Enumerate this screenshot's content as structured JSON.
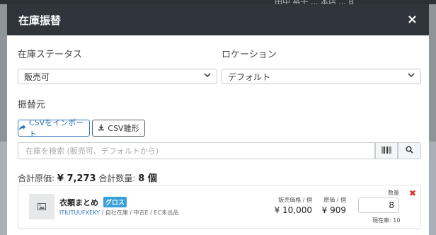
{
  "background": {
    "topbar_text": "田中 裕子 ... 本店 ... B"
  },
  "modal": {
    "title": "在庫振替",
    "close_symbol": "×"
  },
  "form": {
    "status_label": "在庫ステータス",
    "status_value": "販売可",
    "location_label": "ロケーション",
    "location_value": "デフォルト",
    "source_label": "振替元",
    "import_button": "CSVをインポート",
    "template_button": "CSV雛形",
    "search_placeholder": "在庫を検索 (販売可、デフォルトから)"
  },
  "totals": {
    "cost_label": "合計原価:",
    "cost_value": "¥ 7,273",
    "qty_label": "合計数量:",
    "qty_value": "8 個"
  },
  "item": {
    "name": "衣類まとめ",
    "badge": "グロス",
    "code": "ITIUTUUFXEKY",
    "meta": " / 自社在庫 / 中古E / EC未出品",
    "sale_price_label": "販売価格 / 個",
    "sale_price_value": "¥ 10,000",
    "cost_label": "原価 / 個",
    "cost_value": "¥ 909",
    "qty_label": "数量",
    "qty_value": "8",
    "stock_note": "現在庫: 10",
    "remove_symbol": "✖"
  },
  "icons": {
    "import": "share-icon",
    "template": "download-icon",
    "barcode": "barcode-icon",
    "search": "search-icon",
    "thumb": "image-icon"
  },
  "colors": {
    "header_bg": "#2f353a",
    "accent": "#2a6fb5",
    "badge": "#39a0d9",
    "remove": "#e0312f"
  }
}
